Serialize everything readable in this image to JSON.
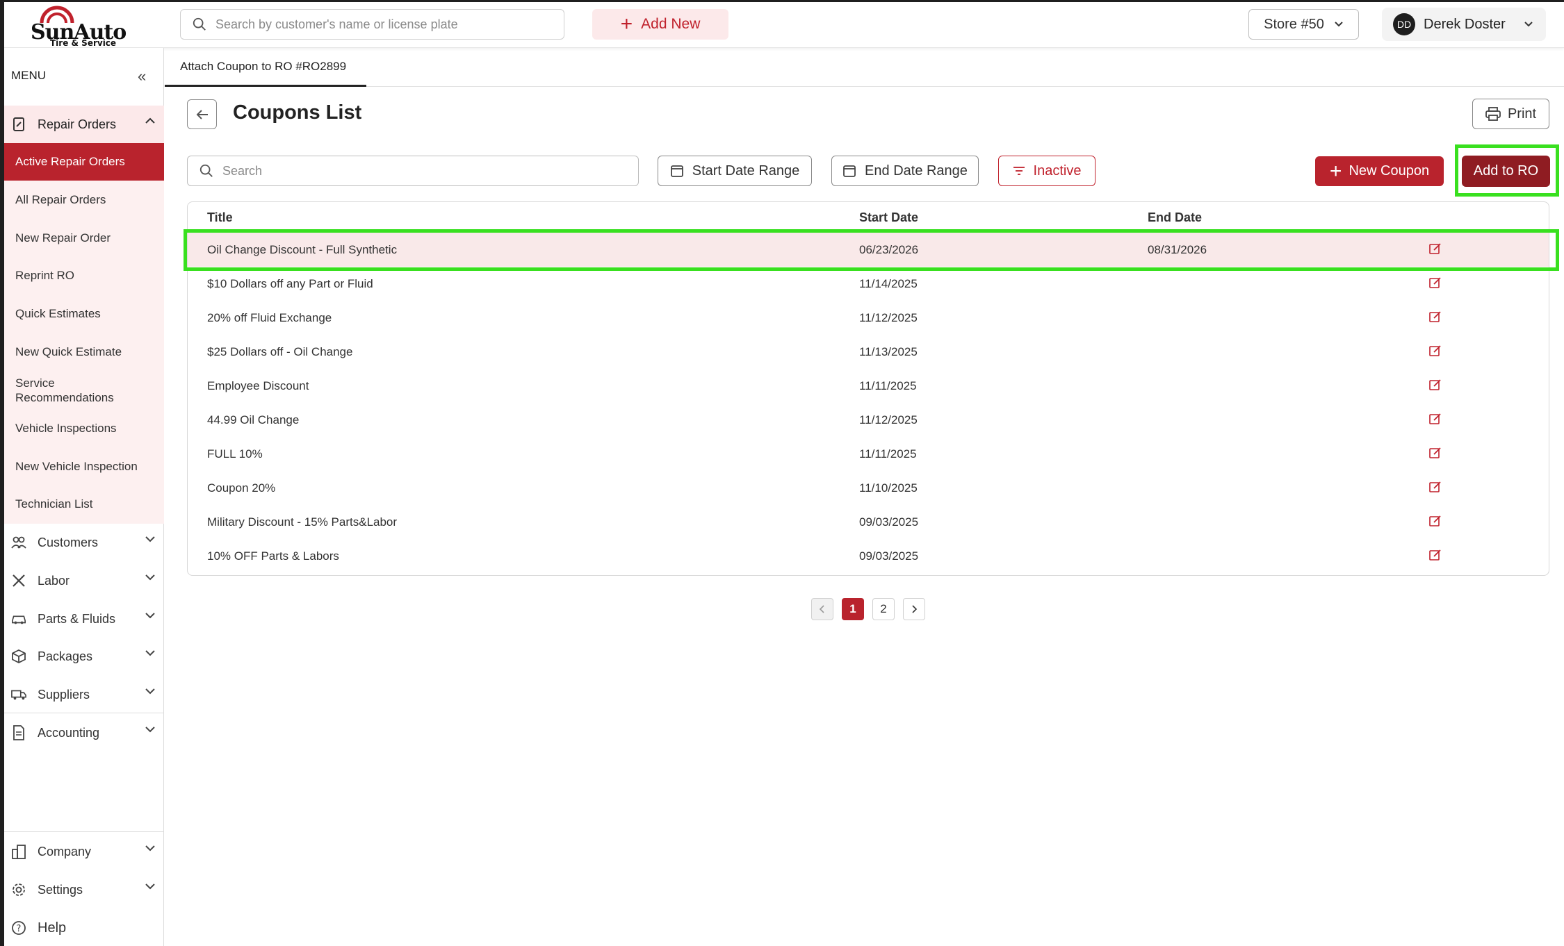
{
  "brand": {
    "name": "SunAuto",
    "tagline": "Tire & Service"
  },
  "header": {
    "search_placeholder": "Search by customer's name or license plate",
    "add_new": "Add New",
    "store": "Store #50",
    "user_initials": "DD",
    "user_name": "Derek Doster"
  },
  "sidebar": {
    "menu_label": "MENU",
    "repair_orders": {
      "label": "Repair Orders",
      "items": [
        "Active Repair Orders",
        "All Repair Orders",
        "New Repair Order",
        "Reprint RO",
        "Quick Estimates",
        "New Quick Estimate",
        "Service Recommendations",
        "Vehicle Inspections",
        "New Vehicle Inspection",
        "Technician List"
      ]
    },
    "groups": [
      "Customers",
      "Labor",
      "Parts & Fluids",
      "Packages",
      "Suppliers",
      "Accounting"
    ],
    "bottom_groups": [
      "Company",
      "Settings"
    ],
    "help": "Help"
  },
  "tab": {
    "label": "Attach Coupon to RO #RO2899"
  },
  "page": {
    "title": "Coupons List",
    "print": "Print",
    "search_placeholder": "Search",
    "start_date_range": "Start Date Range",
    "end_date_range": "End Date Range",
    "inactive": "Inactive",
    "new_coupon": "New Coupon",
    "add_to_ro": "Add to RO"
  },
  "table": {
    "columns": [
      "Title",
      "Start Date",
      "End Date"
    ],
    "rows": [
      {
        "title": "Oil Change Discount - Full Synthetic",
        "start": "06/23/2026",
        "end": "08/31/2026"
      },
      {
        "title": "$10 Dollars off any Part or Fluid",
        "start": "11/14/2025",
        "end": ""
      },
      {
        "title": "20% off Fluid Exchange",
        "start": "11/12/2025",
        "end": ""
      },
      {
        "title": "$25 Dollars off - Oil Change",
        "start": "11/13/2025",
        "end": ""
      },
      {
        "title": "Employee Discount",
        "start": "11/11/2025",
        "end": ""
      },
      {
        "title": "44.99 Oil Change",
        "start": "11/12/2025",
        "end": ""
      },
      {
        "title": "FULL 10%",
        "start": "11/11/2025",
        "end": ""
      },
      {
        "title": "Coupon 20%",
        "start": "11/10/2025",
        "end": ""
      },
      {
        "title": "Military Discount - 15% Parts&Labor",
        "start": "09/03/2025",
        "end": ""
      },
      {
        "title": "10% OFF Parts & Labors",
        "start": "09/03/2025",
        "end": ""
      }
    ]
  },
  "pagination": {
    "pages": [
      "1",
      "2"
    ],
    "current": "1"
  },
  "colors": {
    "brand_red": "#b9232d",
    "dark_red": "#8f1c22",
    "highlight_green": "#39e01f",
    "light_pink": "#fce9ea"
  }
}
